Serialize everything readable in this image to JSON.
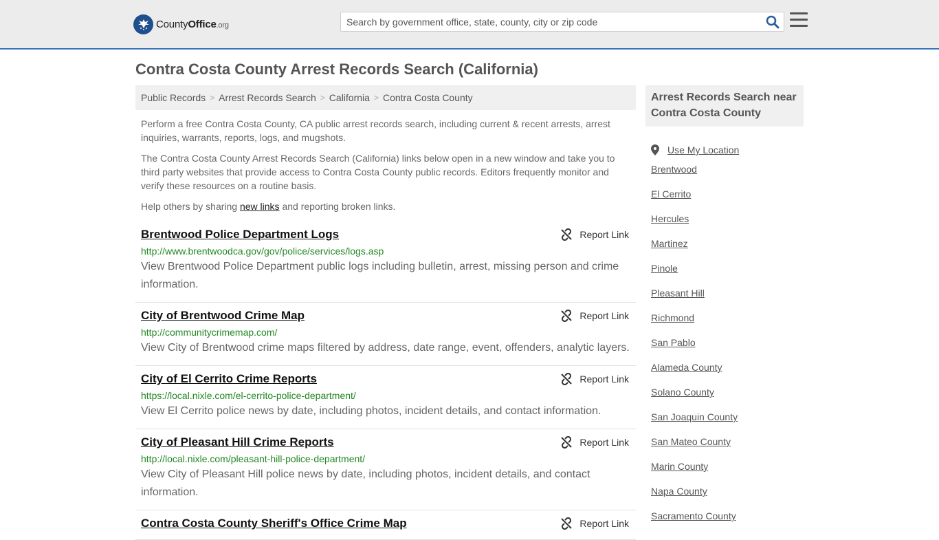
{
  "header": {
    "logo_text_county": "County",
    "logo_text_office": "Office",
    "logo_text_org": ".org",
    "search_placeholder": "Search by government office, state, county, city or zip code"
  },
  "page_title": "Contra Costa County Arrest Records Search (California)",
  "breadcrumb": [
    "Public Records",
    "Arrest Records Search",
    "California",
    "Contra Costa County"
  ],
  "intro": {
    "p1": "Perform a free Contra Costa County, CA public arrest records search, including current & recent arrests, arrest inquiries, warrants, reports, logs, and mugshots.",
    "p2": "The Contra Costa County Arrest Records Search (California) links below open in a new window and take you to third party websites that provide access to Contra Costa County public records. Editors frequently monitor and verify these resources on a routine basis.",
    "p3_before": "Help others by sharing ",
    "p3_link": "new links",
    "p3_after": " and reporting broken links."
  },
  "report_label": "Report Link",
  "results": [
    {
      "title": "Brentwood Police Department Logs",
      "url": "http://www.brentwoodca.gov/gov/police/services/logs.asp",
      "desc": "View Brentwood Police Department public logs including bulletin, arrest, missing person and crime information."
    },
    {
      "title": "City of Brentwood Crime Map",
      "url": "http://communitycrimemap.com/",
      "desc": "View City of Brentwood crime maps filtered by address, date range, event, offenders, analytic layers."
    },
    {
      "title": "City of El Cerrito Crime Reports",
      "url": "https://local.nixle.com/el-cerrito-police-department/",
      "desc": "View El Cerrito police news by date, including photos, incident details, and contact information."
    },
    {
      "title": "City of Pleasant Hill Crime Reports",
      "url": "http://local.nixle.com/pleasant-hill-police-department/",
      "desc": "View City of Pleasant Hill police news by date, including photos, incident details, and contact information."
    },
    {
      "title": "Contra Costa County Sheriff's Office Crime Map",
      "url": "",
      "desc": ""
    }
  ],
  "sidebar": {
    "heading": "Arrest Records Search near Contra Costa County",
    "use_location": "Use My Location",
    "items": [
      "Brentwood",
      "El Cerrito",
      "Hercules",
      "Martinez",
      "Pinole",
      "Pleasant Hill",
      "Richmond",
      "San Pablo",
      "Alameda County",
      "Solano County",
      "San Joaquin County",
      "San Mateo County",
      "Marin County",
      "Napa County",
      "Sacramento County"
    ]
  },
  "colors": {
    "header_bg": "#ececec",
    "header_border": "#3b74b8",
    "link_green": "#228822",
    "logo_blue": "#1f4f8c"
  },
  "icons": {
    "logo": "eagle-seal-icon",
    "search": "magnifier-icon",
    "menu": "hamburger-icon",
    "report": "broken-link-icon",
    "location": "map-pin-icon"
  }
}
